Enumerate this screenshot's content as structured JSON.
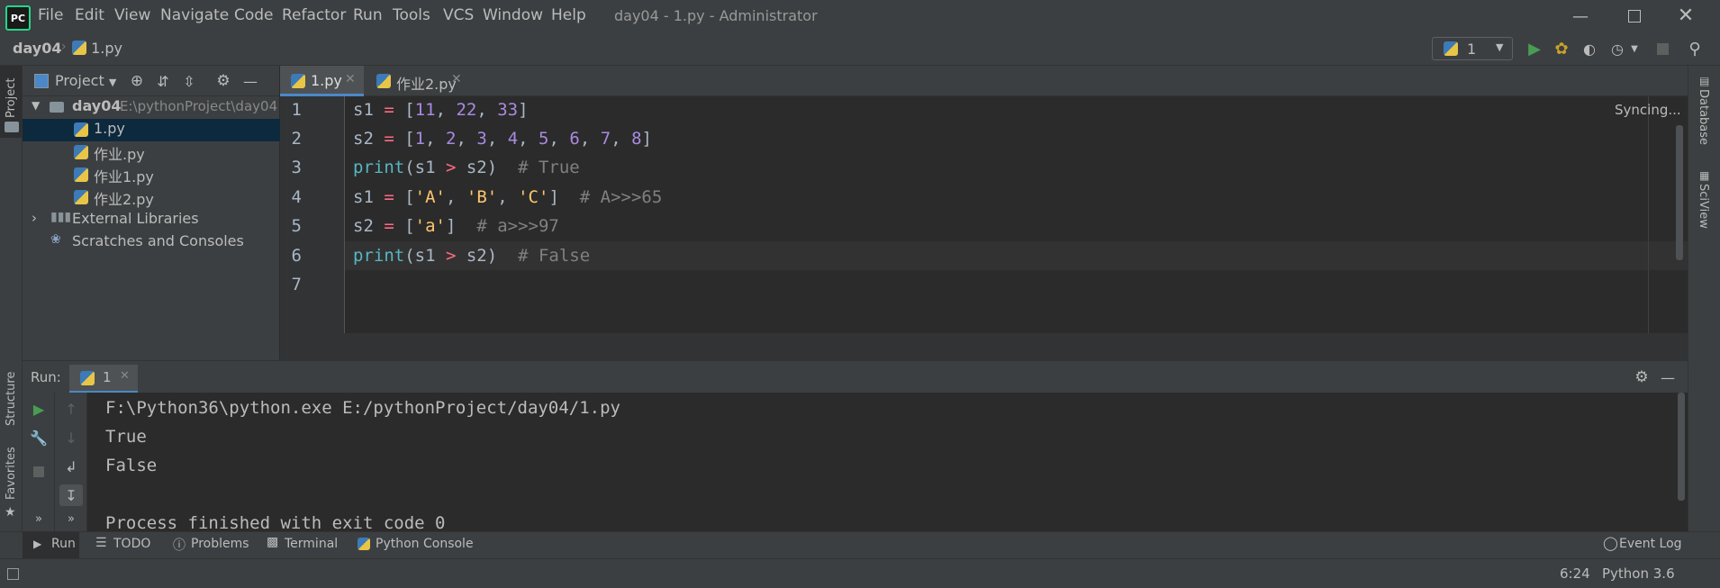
{
  "titlebar": {
    "menu": [
      "File",
      "Edit",
      "View",
      "Navigate",
      "Code",
      "Refactor",
      "Run",
      "Tools",
      "VCS",
      "Window",
      "Help"
    ],
    "title": "day04 - 1.py - Administrator",
    "app_icon_text": "PC"
  },
  "navbar": {
    "breadcrumb_project": "day04",
    "breadcrumb_file": "1.py",
    "run_config": "1"
  },
  "leftstrip": {
    "project": "Project",
    "structure": "Structure",
    "favorites": "Favorites"
  },
  "rightstrip": {
    "database": "Database",
    "sciview": "SciView"
  },
  "project_panel": {
    "header": "Project",
    "root_name": "day04",
    "root_path": "E:\\pythonProject\\day04",
    "files": [
      "1.py",
      "作业.py",
      "作业1.py",
      "作业2.py"
    ],
    "external_libraries": "External Libraries",
    "scratches": "Scratches and Consoles"
  },
  "editor": {
    "tabs": [
      "1.py",
      "作业2.py"
    ],
    "status": "Syncing...",
    "line_numbers": [
      "1",
      "2",
      "3",
      "4",
      "5",
      "6",
      "7"
    ],
    "lines": {
      "l1": {
        "a": "s1",
        "b": " = [",
        "n1": "11",
        "c1": ", ",
        "n2": "22",
        "c2": ", ",
        "n3": "33",
        "d": "]"
      },
      "l2": {
        "a": "s2",
        "b": " = [",
        "vals": [
          "1",
          "2",
          "3",
          "4",
          "5",
          "6",
          "7",
          "8"
        ],
        "d": "]"
      },
      "l3": {
        "fn": "print",
        "p": "(s1 ",
        "op": ">",
        "q": " s2)",
        "cm": "  # True"
      },
      "l4": {
        "a": "s1",
        "b": " = [",
        "s1": "'A'",
        "s2": "'B'",
        "s3": "'C'",
        "d": "]",
        "cm": "  # A>>>65"
      },
      "l5": {
        "a": "s2",
        "b": " = [",
        "s1": "'a'",
        "d": "]",
        "cm": "  # a>>>97"
      },
      "l6": {
        "fn": "print",
        "p": "(s1 ",
        "op": ">",
        "q": " s2)",
        "cm": "  # False"
      }
    }
  },
  "run_panel": {
    "label": "Run:",
    "tab": "1",
    "output": [
      "F:\\Python36\\python.exe E:/pythonProject/day04/1.py",
      "True",
      "False",
      "",
      "Process finished with exit code 0"
    ]
  },
  "bottom_tabs": [
    "Run",
    "TODO",
    "Problems",
    "Terminal",
    "Python Console"
  ],
  "event_log": "Event Log",
  "statusbar": {
    "position": "6:24",
    "interpreter": "Python 3.6"
  },
  "colors": {
    "run_green": "#499c54",
    "debug_yellow": "#c9a227",
    "selection": "#0d293e"
  }
}
